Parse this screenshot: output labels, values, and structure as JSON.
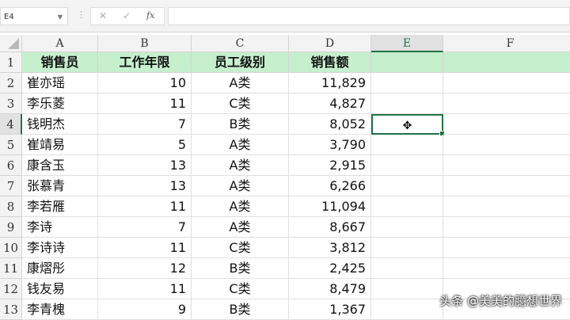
{
  "formula_bar": {
    "name_box": "E4",
    "fx_label": "fx",
    "cancel": "✕",
    "confirm": "✓",
    "formula": ""
  },
  "columns": [
    "A",
    "B",
    "C",
    "D",
    "E",
    "F"
  ],
  "headers": [
    "销售员",
    "工作年限",
    "员工级别",
    "销售额"
  ],
  "rows": [
    [
      "崔亦瑶",
      "10",
      "A类",
      "11,829"
    ],
    [
      "李乐菱",
      "11",
      "C类",
      "4,827"
    ],
    [
      "钱明杰",
      "7",
      "B类",
      "8,052"
    ],
    [
      "崔靖易",
      "5",
      "A类",
      "3,790"
    ],
    [
      "康含玉",
      "13",
      "A类",
      "2,915"
    ],
    [
      "张慕青",
      "13",
      "A类",
      "6,266"
    ],
    [
      "李若雁",
      "11",
      "A类",
      "11,094"
    ],
    [
      "李诗",
      "7",
      "A类",
      "8,667"
    ],
    [
      "李诗诗",
      "11",
      "C类",
      "3,812"
    ],
    [
      "康熠彤",
      "12",
      "B类",
      "2,425"
    ],
    [
      "钱友易",
      "11",
      "C类",
      "8,479"
    ],
    [
      "李青槐",
      "9",
      "B类",
      "1,367"
    ]
  ],
  "row_numbers": [
    "1",
    "2",
    "3",
    "4",
    "5",
    "6",
    "7",
    "8",
    "9",
    "10",
    "11",
    "12",
    "13"
  ],
  "cursor": "✥",
  "watermark": "头条 @美美的臆想世界"
}
